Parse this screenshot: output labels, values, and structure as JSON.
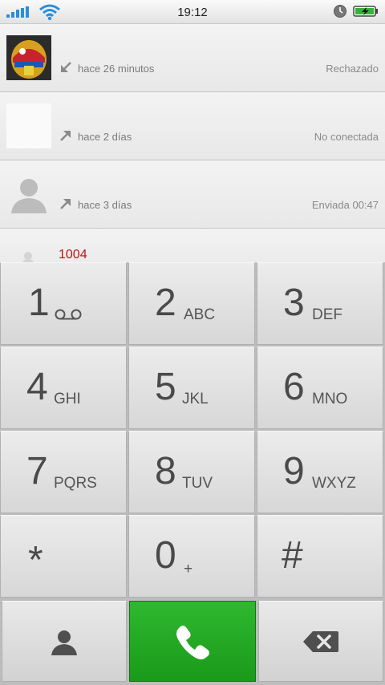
{
  "status_bar": {
    "time": "19:12",
    "icons": [
      "signal-icon",
      "wifi-icon",
      "clock-icon",
      "battery-charging-icon"
    ],
    "accent_color": "#2a8de0"
  },
  "call_log": [
    {
      "time": "hace 26 minutos",
      "status": "Rechazado",
      "direction": "incoming",
      "avatar": "contact-photo"
    },
    {
      "time": "hace 2 días",
      "status": "No conectada",
      "direction": "outgoing",
      "avatar": "blank"
    },
    {
      "time": "hace 3 días",
      "status": "Enviada 00:47",
      "direction": "outgoing",
      "avatar": "person-placeholder"
    }
  ],
  "partial_entry": {
    "number": "1004"
  },
  "keypad": [
    {
      "digit": "1",
      "letters": "",
      "icon": "voicemail-icon"
    },
    {
      "digit": "2",
      "letters": "ABC"
    },
    {
      "digit": "3",
      "letters": "DEF"
    },
    {
      "digit": "4",
      "letters": "GHI"
    },
    {
      "digit": "5",
      "letters": "JKL"
    },
    {
      "digit": "6",
      "letters": "MNO"
    },
    {
      "digit": "7",
      "letters": "PQRS"
    },
    {
      "digit": "8",
      "letters": "TUV"
    },
    {
      "digit": "9",
      "letters": "WXYZ"
    },
    {
      "digit": "*",
      "letters": ""
    },
    {
      "digit": "0",
      "letters": "+"
    },
    {
      "digit": "#",
      "letters": ""
    }
  ],
  "actions": {
    "contacts_icon": "contacts-icon",
    "call_icon": "phone-icon",
    "call_color": "#22a822",
    "delete_icon": "backspace-icon"
  }
}
